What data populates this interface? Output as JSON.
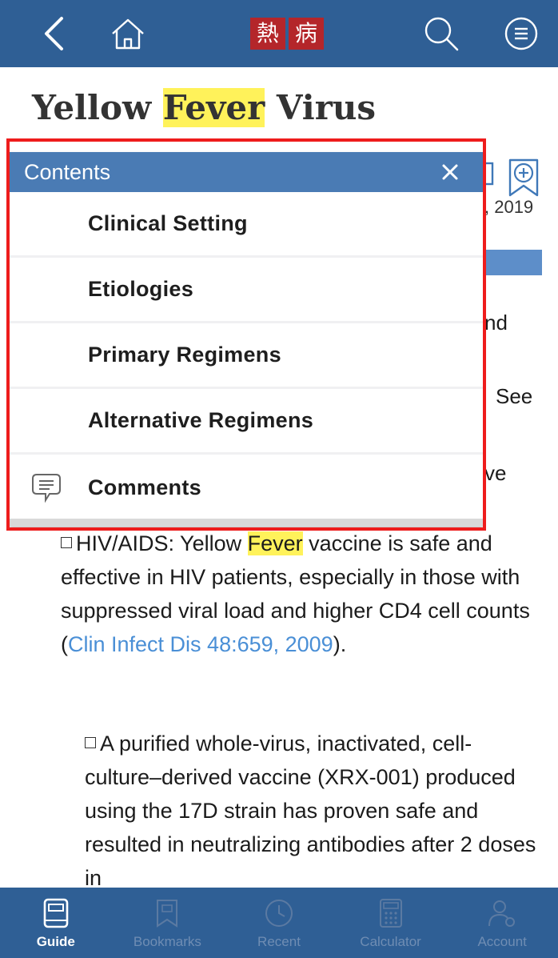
{
  "header": {
    "logo_chars": [
      "熱",
      "病"
    ],
    "icons": [
      "back-icon",
      "home-icon",
      "search-icon",
      "menu-icon"
    ]
  },
  "page": {
    "title_before": "Yellow ",
    "title_highlight": "Fever",
    "title_after": " Virus",
    "date_fragment": ", 2019",
    "frag1": "nd",
    "frag2": "See",
    "frag3": "ve"
  },
  "contents": {
    "title": "Contents",
    "items": [
      {
        "label": "Clinical Setting"
      },
      {
        "label": "Etiologies"
      },
      {
        "label": "Primary Regimens"
      },
      {
        "label": "Alternative Regimens"
      },
      {
        "label": "Comments",
        "icon": "comment-icon"
      }
    ]
  },
  "body": {
    "p1_before": "HIV/AIDS: Yellow ",
    "p1_highlight": "Fever",
    "p1_after": " vaccine is safe and effective in HIV patients, especially in those with suppressed viral load and higher CD4 cell counts (",
    "p1_link": "Clin Infect Dis 48:659, 2009",
    "p1_end": ").",
    "p2": "A purified whole-virus, inactivated, cell-culture–derived vaccine (XRX-001) produced using the 17D strain has proven safe and resulted in neutralizing antibodies after 2 doses in"
  },
  "tabs": [
    {
      "label": "Guide",
      "icon": "book-icon",
      "active": true
    },
    {
      "label": "Bookmarks",
      "icon": "bookmarks-icon",
      "active": false
    },
    {
      "label": "Recent",
      "icon": "recent-icon",
      "active": false
    },
    {
      "label": "Calculator",
      "icon": "calculator-icon",
      "active": false
    },
    {
      "label": "Account",
      "icon": "account-icon",
      "active": false
    }
  ],
  "colors": {
    "bar": "#2f5f95",
    "popup_header": "#4a7bb4",
    "highlight": "#fff25a",
    "link": "#4a8fd6",
    "frame": "#ee1c1c"
  }
}
